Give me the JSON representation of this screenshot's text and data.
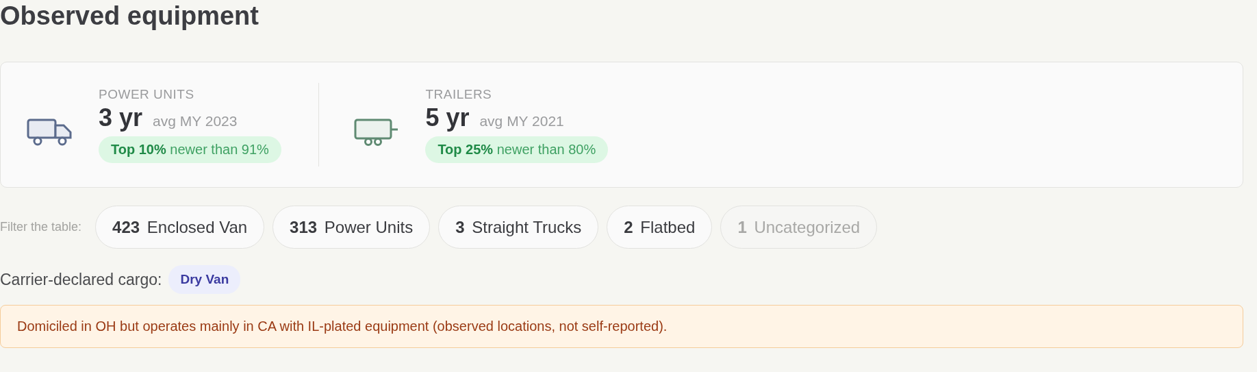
{
  "heading": "Observed equipment",
  "summary": [
    {
      "kind": "truck",
      "label": "POWER UNITS",
      "age": "3 yr",
      "model_year": "avg MY 2023",
      "rank": "Top 10%",
      "comparison": "newer than 91%"
    },
    {
      "kind": "trailer",
      "label": "TRAILERS",
      "age": "5 yr",
      "model_year": "avg MY 2021",
      "rank": "Top 25%",
      "comparison": "newer than 80%"
    }
  ],
  "filter": {
    "label": "Filter the table:",
    "chips": [
      {
        "count": "423",
        "label": "Enclosed Van",
        "disabled": false
      },
      {
        "count": "313",
        "label": "Power Units",
        "disabled": false
      },
      {
        "count": "3",
        "label": "Straight Trucks",
        "disabled": false
      },
      {
        "count": "2",
        "label": "Flatbed",
        "disabled": false
      },
      {
        "count": "1",
        "label": "Uncategorized",
        "disabled": true
      }
    ]
  },
  "cargo": {
    "label": "Carrier-declared cargo:",
    "tags": [
      "Dry Van"
    ]
  },
  "alert": "Domiciled in OH but operates mainly in CA with IL-plated equipment (observed locations, not self-reported)."
}
